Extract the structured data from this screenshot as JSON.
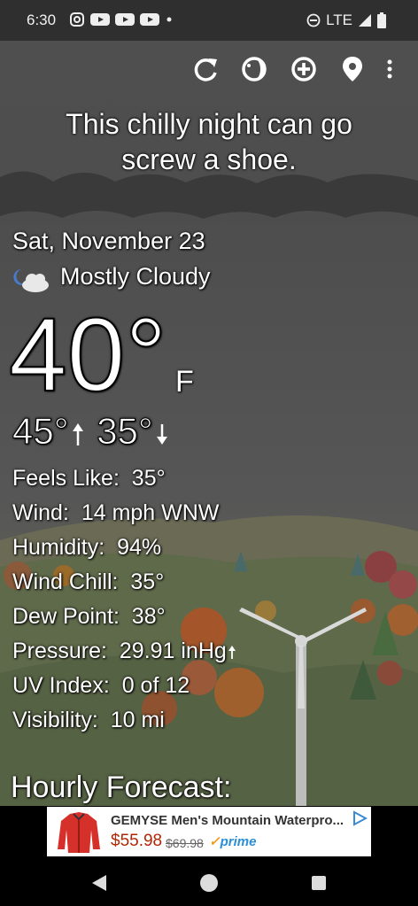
{
  "status_bar": {
    "time": "6:30",
    "network": "LTE",
    "icons": [
      "instagram-icon",
      "youtube-icon",
      "youtube-icon",
      "youtube-icon",
      "dot-icon",
      "dnd-icon",
      "signal-icon",
      "battery-icon"
    ]
  },
  "toolbar": {
    "icons": [
      "refresh-icon",
      "theme-icon",
      "add-location-icon",
      "location-pin-icon",
      "overflow-menu-icon"
    ]
  },
  "headline": {
    "line1": "This chilly night can go",
    "line2": "screw a shoe."
  },
  "weather": {
    "date": "Sat, November 23",
    "condition": "Mostly Cloudy",
    "condition_icon": "partly-cloudy-night-icon",
    "temperature": "40°",
    "unit": "F",
    "high": "45°",
    "low": "35°",
    "details": [
      {
        "label": "Feels Like:",
        "value": "35°"
      },
      {
        "label": "Wind:",
        "value": "14 mph WNW"
      },
      {
        "label": "Humidity:",
        "value": "94%"
      },
      {
        "label": "Wind Chill:",
        "value": "35°"
      },
      {
        "label": "Dew Point:",
        "value": "38°"
      },
      {
        "label": "Pressure:",
        "value": "29.91 inHg"
      },
      {
        "label": "UV Index:",
        "value": "0 of 12"
      },
      {
        "label": "Visibility:",
        "value": "10 mi"
      }
    ],
    "hourly_heading": "Hourly Forecast:"
  },
  "ad": {
    "title": "GEMYSE Men's Mountain Waterpro...",
    "price": "$55.98",
    "old_price": "$69.98",
    "badge": "prime",
    "badge_check": "✓"
  },
  "colors": {
    "status_bar": "#2f2f2f",
    "sky": "#4e4e4e",
    "price": "#b12704",
    "prime": "#2a8fd6"
  }
}
